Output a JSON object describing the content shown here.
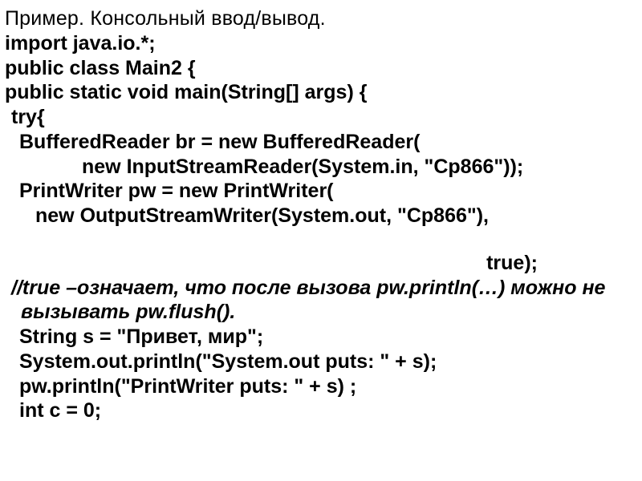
{
  "title": "Пример. Консольный ввод/вывод.",
  "code": {
    "l1": "import java.io.*;",
    "l2": "public class Main2 {",
    "l3": "public static void main(String[] args) {",
    "l4": "try{",
    "l5": "BufferedReader br = new BufferedReader(",
    "l6": "new InputStreamReader(System.in, \"Cp866\"));",
    "l7": "PrintWriter pw = new PrintWriter(",
    "l8": "new OutputStreamWriter(System.out, \"Cp866\"),",
    "l9": "true);",
    "comment": "//true –означает, что после вызова pw.println(…) можно не вызывать pw.flush().",
    "l10": "String s = \"Привет, мир\";",
    "l11": "System.out.println(\"System.out puts: \" + s);",
    "l12": "pw.println(\"PrintWriter puts: \" + s) ;",
    "l13": "int c = 0;"
  }
}
